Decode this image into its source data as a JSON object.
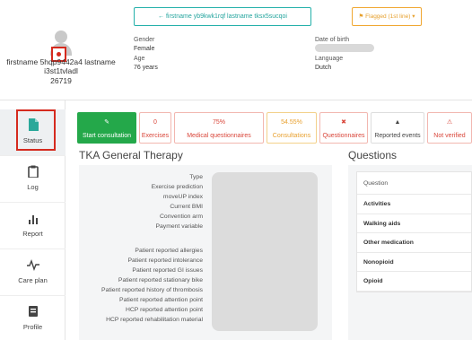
{
  "patient": {
    "name": "firstname 5hqp9442a4 lastname i3st1tvladl",
    "id": "26719"
  },
  "header": {
    "back_link": "← firstname yb9kwk1rqf lastname tksx5sucqoi",
    "flagged": "⚑ Flagged (1st line) ▾",
    "fields": {
      "gender_label": "Gender",
      "gender_value": "Female",
      "age_label": "Age",
      "age_value": "76 years",
      "dob_label": "Date of birth",
      "language_label": "Language",
      "language_value": "Dutch"
    }
  },
  "sidebar": {
    "items": [
      {
        "label": "Status",
        "icon": "file-icon"
      },
      {
        "label": "Log",
        "icon": "clipboard-icon"
      },
      {
        "label": "Report",
        "icon": "bar-chart-icon"
      },
      {
        "label": "Care plan",
        "icon": "pulse-icon"
      },
      {
        "label": "Profile",
        "icon": "id-card-icon"
      }
    ]
  },
  "status_bar": {
    "start": {
      "value": "✎",
      "label": "Start consultation"
    },
    "exercises": {
      "value": "0",
      "label": "Exercises"
    },
    "medical_questionnaires": {
      "value": "75%",
      "label": "Medical questionnaires"
    },
    "consultations": {
      "value": "54.55%",
      "label": "Consultations"
    },
    "questionnaires": {
      "value": "✖",
      "label": "Questionnaires"
    },
    "reported_events": {
      "value": "▲",
      "label": "Reported events"
    },
    "not_verified": {
      "value": "⚠",
      "label": "Not verified"
    }
  },
  "therapy": {
    "title": "TKA General Therapy",
    "fields": [
      "Type",
      "Exercise prediction",
      "moveUP index",
      "Current BMI",
      "Convention arm",
      "Payment variable",
      "Patient reported allergies",
      "Patient reported intolerance",
      "Patient reported GI issues",
      "Patient reported stationary bike",
      "Patient reported history of thrombosis",
      "Patient reported attention point",
      "HCP reported attention point",
      "HCP reported rehabilitation material"
    ]
  },
  "questions": {
    "title": "Questions",
    "header": "Question",
    "rows": [
      "Activities",
      "Walking aids",
      "Other medication",
      "Nonopioid",
      "Opioid"
    ]
  },
  "colors": {
    "accent_teal": "#24a59e",
    "start_green": "#24a84a",
    "warning_red": "#d9463a",
    "warning_orange": "#e8a130",
    "annotation_red": "#d52a1e"
  }
}
